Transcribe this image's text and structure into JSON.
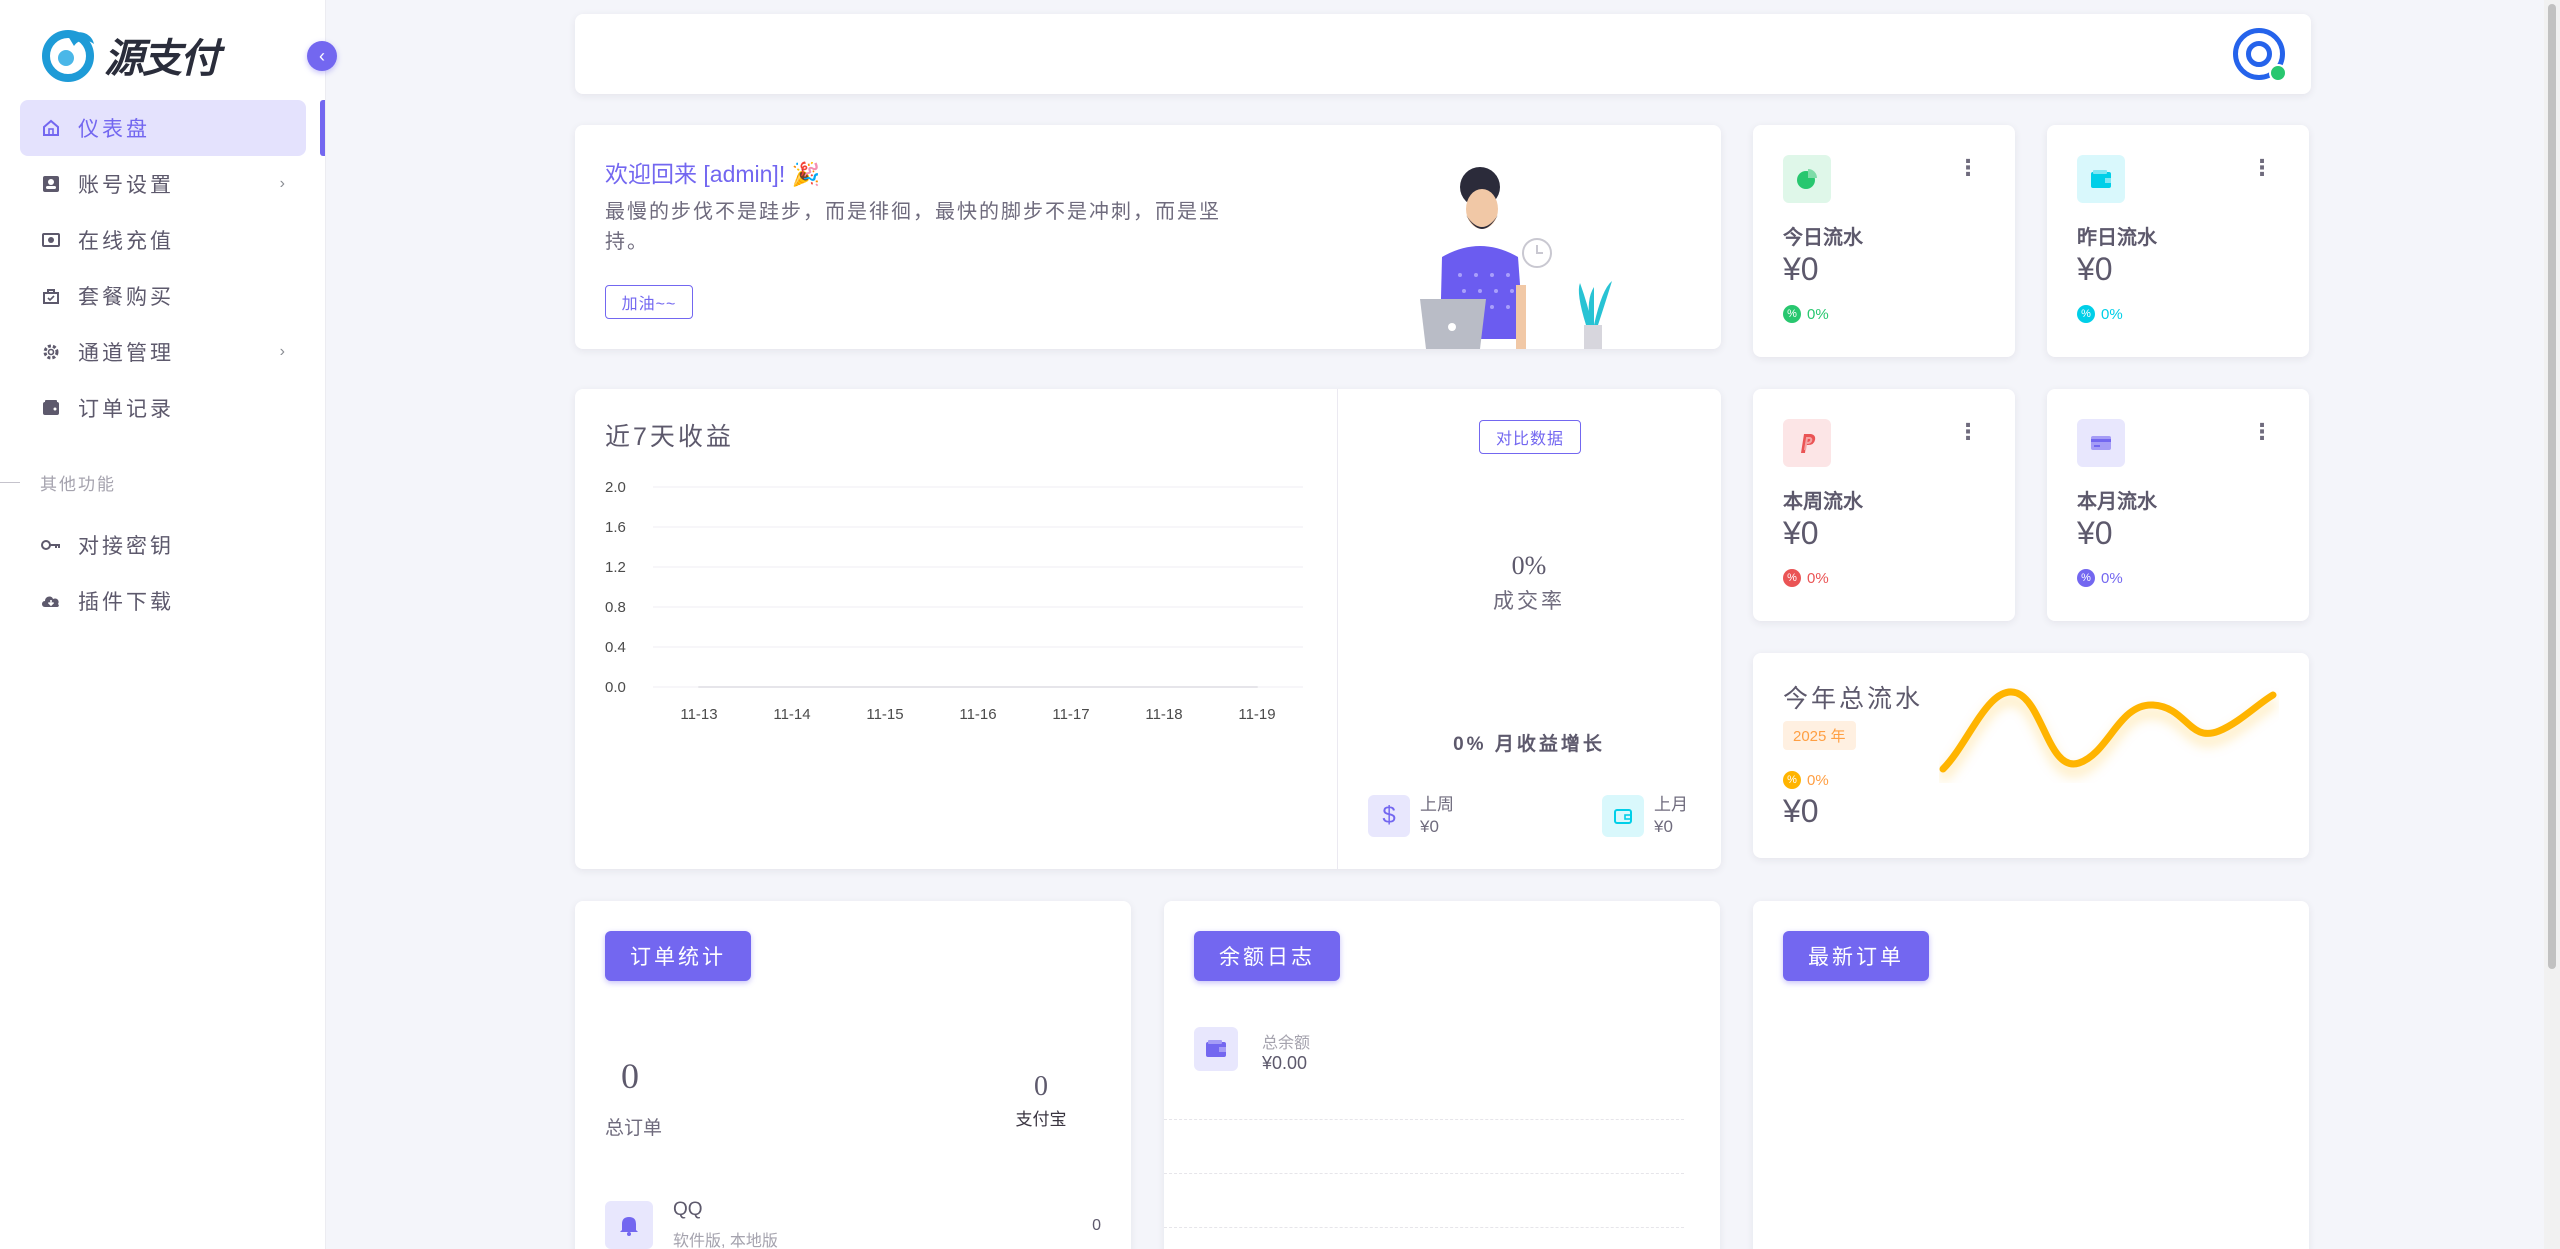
{
  "brand": {
    "logo_text": "源支付"
  },
  "sidebar": {
    "items": [
      {
        "label": "仪表盘",
        "icon": "home-icon",
        "active": true
      },
      {
        "label": "账号设置",
        "icon": "user-card-icon",
        "has_children": true
      },
      {
        "label": "在线充值",
        "icon": "cash-icon"
      },
      {
        "label": "套餐购买",
        "icon": "shopping-bag-icon"
      },
      {
        "label": "通道管理",
        "icon": "gear-icon",
        "has_children": true
      },
      {
        "label": "订单记录",
        "icon": "wallet-icon"
      }
    ],
    "section_label": "其他功能",
    "items2": [
      {
        "label": "对接密钥",
        "icon": "key-icon"
      },
      {
        "label": "插件下载",
        "icon": "cloud-download-icon"
      }
    ]
  },
  "welcome": {
    "title": "欢迎回来 [admin]! 🎉",
    "quote": "最慢的步伐不是跬步，而是徘徊，最快的脚步不是冲刺，而是坚持。",
    "button": "加油~~"
  },
  "stats": [
    {
      "label": "今日流水",
      "value": "¥0",
      "pct": "0%",
      "color": "#28c76f",
      "bg": "#dff7e9",
      "icon": "pie-chart-icon"
    },
    {
      "label": "昨日流水",
      "value": "¥0",
      "pct": "0%",
      "color": "#00cfe8",
      "bg": "#d9f8fc",
      "icon": "wallet-icon"
    },
    {
      "label": "本周流水",
      "value": "¥0",
      "pct": "0%",
      "color": "#ea5455",
      "bg": "#fce5e6",
      "icon": "paypal-icon"
    },
    {
      "label": "本月流水",
      "value": "¥0",
      "pct": "0%",
      "color": "#7367f0",
      "bg": "#e8e7fd",
      "icon": "credit-card-icon"
    }
  ],
  "earnings": {
    "title": "近7天收益",
    "compare_button": "对比数据",
    "rate_value": "0%",
    "rate_label": "成交率",
    "growth_value": "0%",
    "growth_label": "月收益增长",
    "last_week_label": "上周",
    "last_week_value": "¥0",
    "last_month_label": "上月",
    "last_month_value": "¥0"
  },
  "chart_data": {
    "type": "line",
    "title": "近7天收益",
    "categories": [
      "11-13",
      "11-14",
      "11-15",
      "11-16",
      "11-17",
      "11-18",
      "11-19"
    ],
    "series": [
      {
        "values": [
          0,
          0,
          0,
          0,
          0,
          0,
          0
        ]
      }
    ],
    "ylim": [
      0,
      2
    ],
    "yticks": [
      "2.0",
      "1.6",
      "1.2",
      "0.8",
      "0.4",
      "0.0"
    ],
    "grid": true
  },
  "year": {
    "title": "今年总流水",
    "badge": "2025 年",
    "pct": "0%",
    "value": "¥0",
    "line_color": "#ffb400"
  },
  "orders": {
    "button": "订单统计",
    "total_value": "0",
    "total_label": "总订单",
    "alipay_value": "0",
    "alipay_label": "支付宝",
    "row": {
      "name": "QQ",
      "sub": "软件版, 本地版",
      "count": "0"
    }
  },
  "balance": {
    "button": "余额日志",
    "label": "总余额",
    "value": "¥0.00"
  },
  "latest": {
    "button": "最新订单"
  }
}
